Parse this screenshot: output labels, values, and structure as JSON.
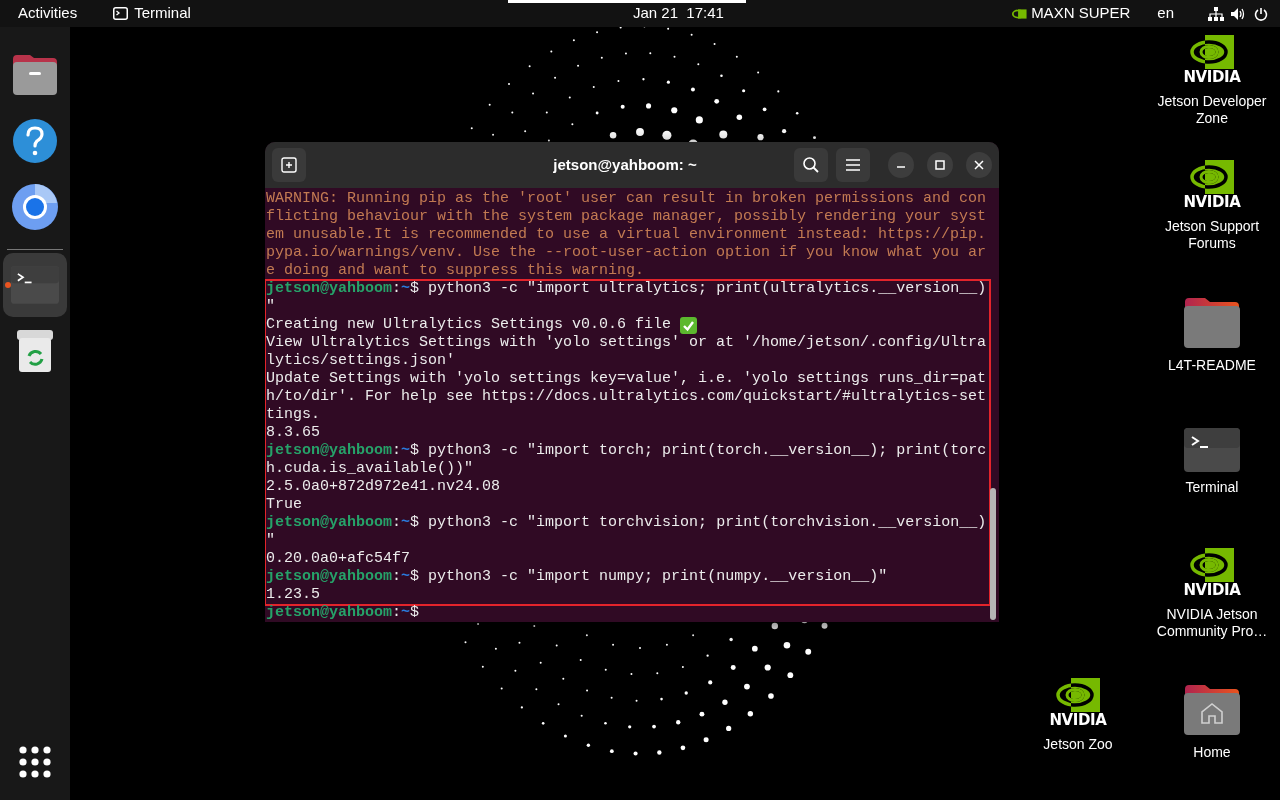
{
  "top_bar": {
    "activities": "Activities",
    "app_name": "Terminal",
    "clock": "Jan 21  17:41",
    "power_mode": "MAXN SUPER",
    "language": "en"
  },
  "dock": {
    "items": [
      {
        "kind": "files",
        "running": false,
        "selected": false
      },
      {
        "kind": "help",
        "running": false,
        "selected": false
      },
      {
        "kind": "browser",
        "running": false,
        "selected": false
      },
      {
        "kind": "terminal",
        "running": true,
        "selected": true
      },
      {
        "kind": "trash",
        "running": false,
        "selected": false
      }
    ]
  },
  "desktop_icons": [
    {
      "kind": "nvidia",
      "brand": "NVIDIA",
      "label": "Jetson Developer Zone"
    },
    {
      "kind": "nvidia",
      "brand": "NVIDIA",
      "label": "Jetson Support Forums"
    },
    {
      "kind": "folder",
      "label": "L4T-README"
    },
    {
      "kind": "terminal",
      "label": "Terminal"
    },
    {
      "kind": "nvidia",
      "brand": "NVIDIA",
      "label": "NVIDIA Jetson Community Pro…"
    },
    {
      "kind": "nvidia",
      "brand": "NVIDIA",
      "label": "Jetson Zoo"
    },
    {
      "kind": "home_folder",
      "label": "Home"
    }
  ],
  "terminal": {
    "title": "jetson@yahboom: ~",
    "blocks": [
      {
        "highlighted": false,
        "lines": [
          {
            "kind": "warning",
            "text": "WARNING: Running pip as the 'root' user can result in broken permissions and con"
          },
          {
            "kind": "warning",
            "text": "flicting behaviour with the system package manager, possibly rendering your syst"
          },
          {
            "kind": "warning",
            "text": "em unusable.It is recommended to use a virtual environment instead: https://pip."
          },
          {
            "kind": "warning",
            "text": "pypa.io/warnings/venv. Use the --root-user-action option if you know what you ar"
          },
          {
            "kind": "warning",
            "text": "e doing and want to suppress this warning."
          }
        ]
      },
      {
        "highlighted": true,
        "lines": [
          {
            "kind": "prompt",
            "user": "jetson@yahboom",
            "separator": ":",
            "path": "~",
            "sign": "$",
            "command": "python3 -c \"import ultralytics; print(ultralytics.__version__)"
          },
          {
            "kind": "output",
            "text": "\""
          },
          {
            "kind": "output",
            "text": "Creating new Ultralytics Settings v0.0.6 file",
            "check": true
          },
          {
            "kind": "output",
            "text": "View Ultralytics Settings with 'yolo settings' or at '/home/jetson/.config/Ultra"
          },
          {
            "kind": "output",
            "text": "lytics/settings.json'"
          },
          {
            "kind": "output",
            "text": "Update Settings with 'yolo settings key=value', i.e. 'yolo settings runs_dir=pat"
          },
          {
            "kind": "output",
            "text": "h/to/dir'. For help see https://docs.ultralytics.com/quickstart/#ultralytics-set"
          },
          {
            "kind": "output",
            "text": "tings."
          },
          {
            "kind": "output",
            "text": "8.3.65"
          },
          {
            "kind": "prompt",
            "user": "jetson@yahboom",
            "separator": ":",
            "path": "~",
            "sign": "$",
            "command": "python3 -c \"import torch; print(torch.__version__); print(torc"
          },
          {
            "kind": "output",
            "text": "h.cuda.is_available())\""
          },
          {
            "kind": "output",
            "text": "2.5.0a0+872d972e41.nv24.08"
          },
          {
            "kind": "output",
            "text": "True"
          },
          {
            "kind": "prompt",
            "user": "jetson@yahboom",
            "separator": ":",
            "path": "~",
            "sign": "$",
            "command": "python3 -c \"import torchvision; print(torchvision.__version__)"
          },
          {
            "kind": "output",
            "text": "\""
          },
          {
            "kind": "output",
            "text": "0.20.0a0+afc54f7"
          },
          {
            "kind": "prompt",
            "user": "jetson@yahboom",
            "separator": ":",
            "path": "~",
            "sign": "$",
            "command": "python3 -c \"import numpy; print(numpy.__version__)\""
          },
          {
            "kind": "output",
            "text": "1.23.5"
          }
        ]
      },
      {
        "highlighted": false,
        "lines": [
          {
            "kind": "prompt",
            "user": "jetson@yahboom",
            "separator": ":",
            "path": "~",
            "sign": "$"
          }
        ]
      }
    ]
  }
}
